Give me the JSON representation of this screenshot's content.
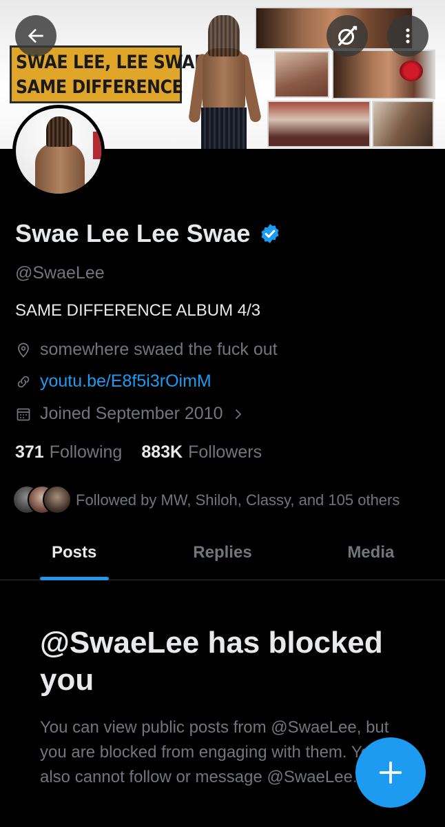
{
  "banner": {
    "sign_line_1": "SWAE LEE, LEE SWAE",
    "sign_line_2": "SAME  DIFFERENCE"
  },
  "header_icons": {
    "back": "arrow-left-icon",
    "grok": "grok-icon",
    "more": "more-vertical-icon"
  },
  "profile": {
    "display_name": "Swae Lee Lee Swae",
    "verified": true,
    "handle": "@SwaeLee",
    "bio": "SAME DIFFERENCE ALBUM 4/3",
    "location": "somewhere swaed the fuck out",
    "link": "youtu.be/E8f5i3rOimM",
    "joined": "Joined September 2010"
  },
  "stats": {
    "following_count": "371",
    "following_label": "Following",
    "followers_count": "883K",
    "followers_label": "Followers"
  },
  "followed_by": "Followed by MW, Shiloh, Classy, and 105 others",
  "tabs": [
    {
      "label": "Posts",
      "active": true
    },
    {
      "label": "Replies",
      "active": false
    },
    {
      "label": "Media",
      "active": false
    }
  ],
  "blocked": {
    "title": "@SwaeLee has blocked you",
    "body": "You can view public posts from @SwaeLee, but you are blocked from engaging with them. You also cannot follow or message @SwaeLee."
  },
  "colors": {
    "accent": "#1d9bf0",
    "background": "#000000",
    "text_primary": "#e7e9ea",
    "text_secondary": "#71767b"
  },
  "fab": {
    "icon": "plus-icon"
  }
}
